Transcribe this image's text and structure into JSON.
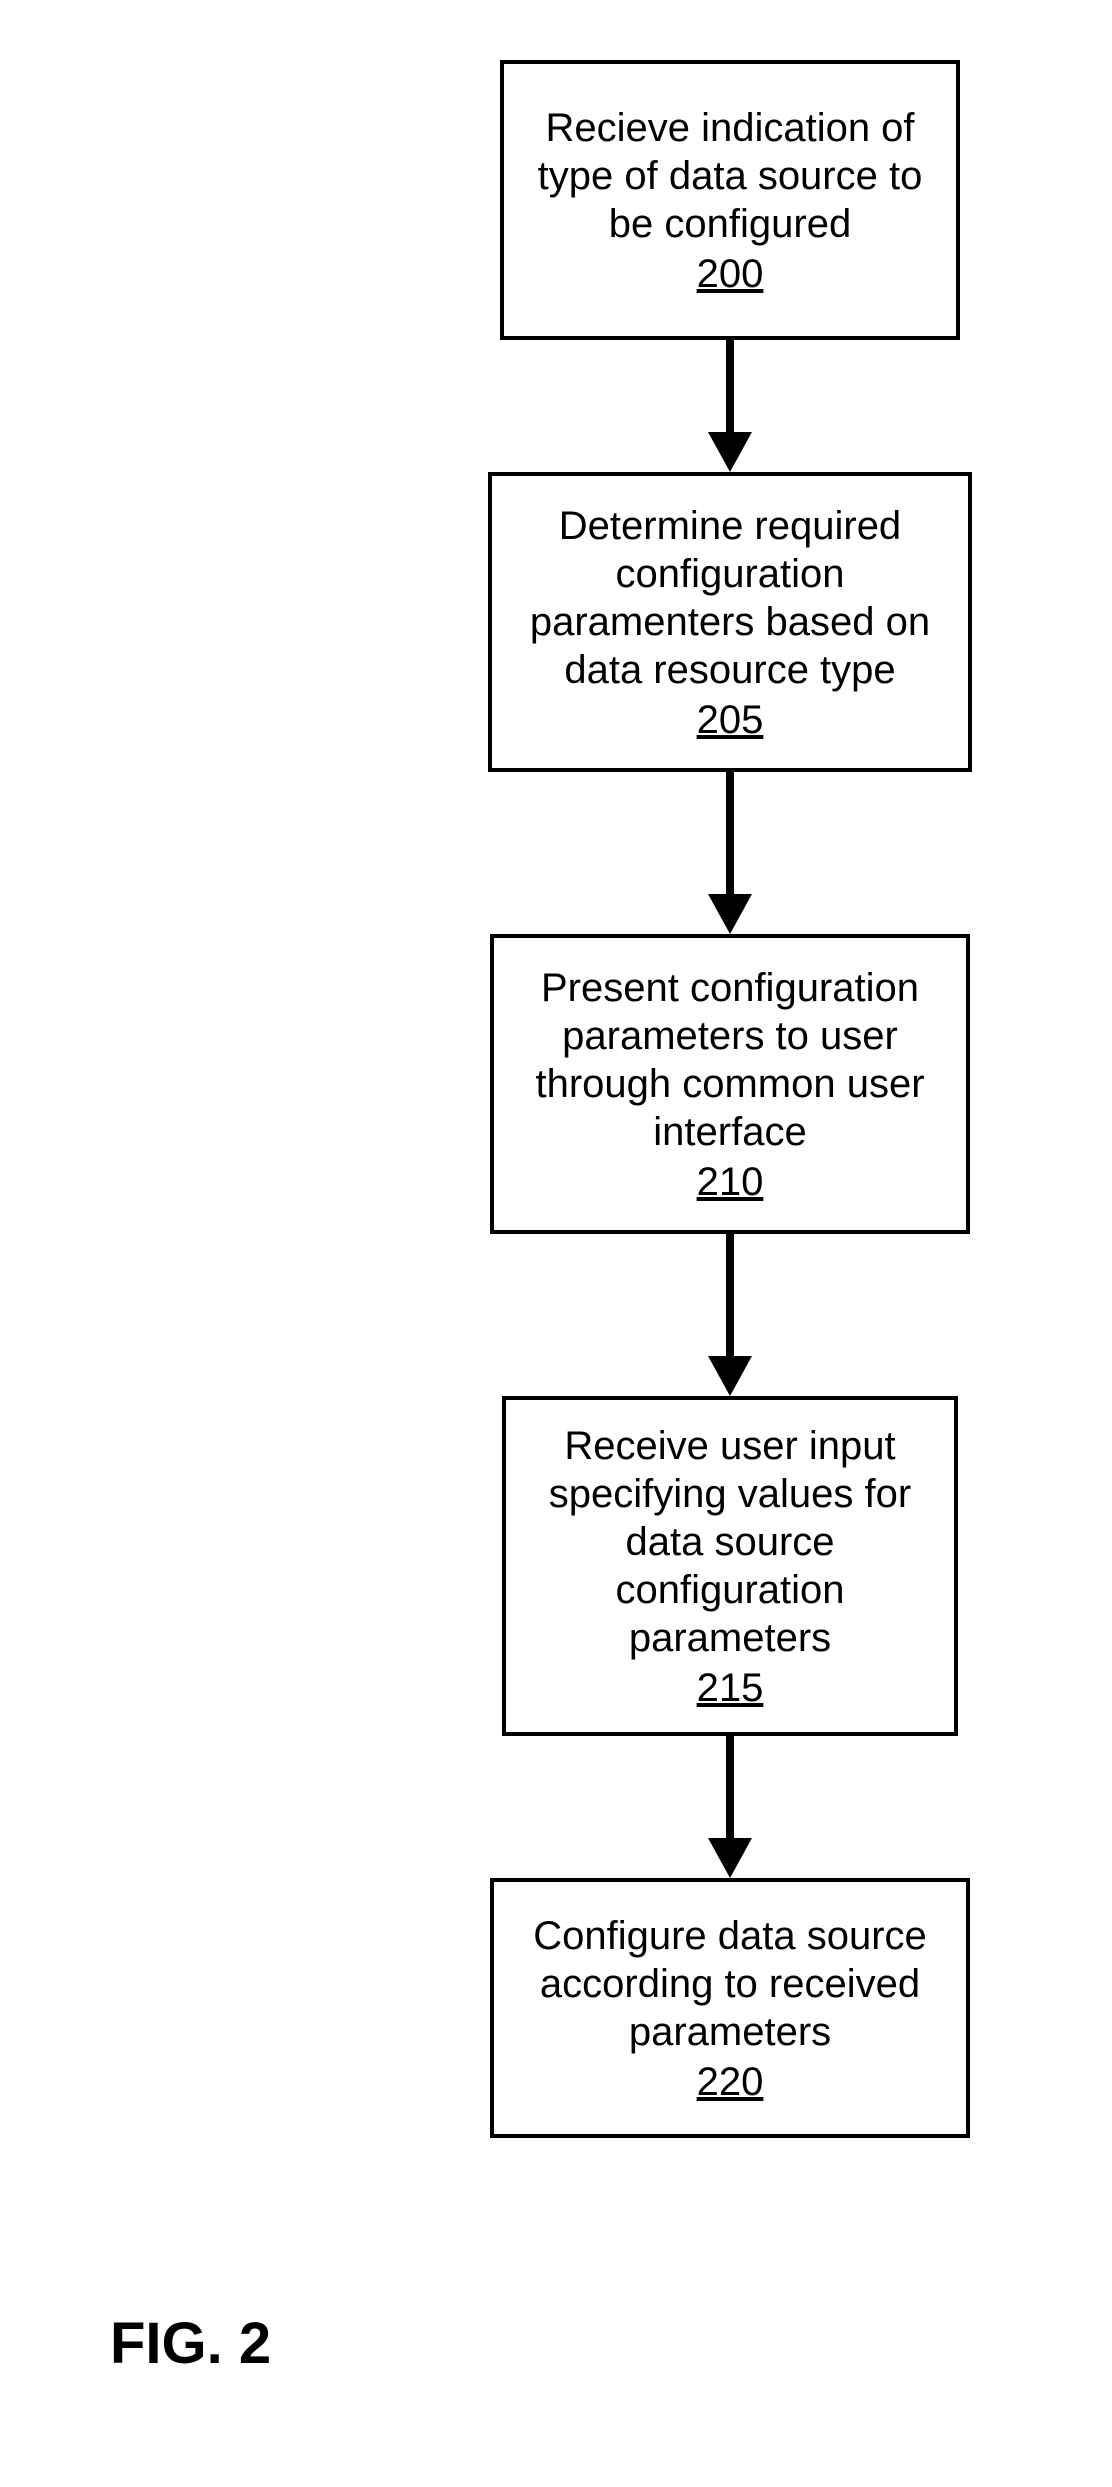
{
  "steps": [
    {
      "text": "Recieve indication of type of data source to be configured",
      "ref": "200"
    },
    {
      "text": "Determine required configuration paramenters based on data resource type",
      "ref": "205"
    },
    {
      "text": "Present configuration parameters to user through common user interface",
      "ref": "210"
    },
    {
      "text": "Receive user input specifying values for data source configuration parameters",
      "ref": "215"
    },
    {
      "text": "Configure data source according to received parameters",
      "ref": "220"
    }
  ],
  "caption": "FIG. 2"
}
